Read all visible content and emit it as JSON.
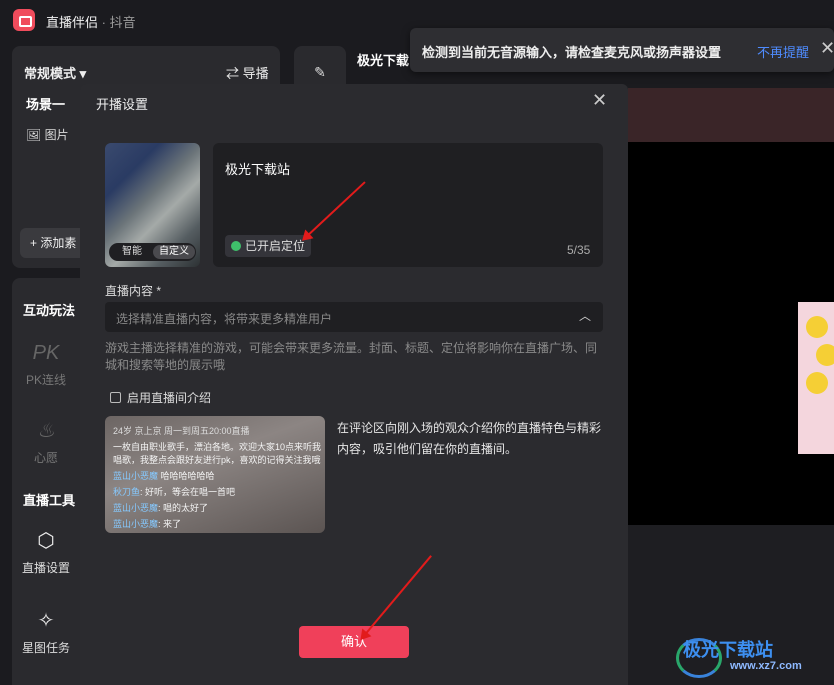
{
  "app": {
    "title": "直播伴侣",
    "subtitle": "· 抖音"
  },
  "left": {
    "mode": "常规模式",
    "guide": "导播",
    "scene": "场景一",
    "image_item": "图片",
    "add_source": "添加素",
    "interact_head": "互动玩法",
    "pk_label": "PK连线",
    "wish_label": "心愿",
    "tools_head": "直播工具",
    "live_settings": "直播设置",
    "star_task": "星图任务"
  },
  "stream_title": "极光下载",
  "notice": {
    "text": "检测到当前无音源输入，请检查麦克风或扬声器设置",
    "link": "不再提醒"
  },
  "modal": {
    "title": "开播设置",
    "cover_tabs": [
      "智能",
      "自定义"
    ],
    "live_title": "极光下载站",
    "location_badge": "已开启定位",
    "char_count": "5/35",
    "content_label": "直播内容 *",
    "content_placeholder": "选择精准直播内容，将带来更多精准用户",
    "hint": "游戏主播选择精准的游戏，可能会带来更多流量。封面、标题、定位将影响你在直播广场、同城和搜索等地的展示哦",
    "intro_checkbox": "启用直播间介绍",
    "intro_desc": "在评论区向刚入场的观众介绍你的直播特色与精彩内容，吸引他们留在你的直播间。",
    "chat": {
      "header": "24岁  京上京  周一到周五20:00直播",
      "body1": "一枚自由职业歌手，漂泊各地。欢迎大家10点来听我",
      "body2": "唱歌，我整点会跟好友进行pk，喜欢的记得关注我哦",
      "l1_user": "蓝山小恶魔",
      "l1_msg": "哈哈哈哈哈哈",
      "l2_user": "秋刀鱼",
      "l2_msg": "好听，等会在唱一首吧",
      "l3_user": "蓝山小恶魔",
      "l3_msg": "唱的太好了",
      "l4_user": "蓝山小恶魔",
      "l4_msg": "来了"
    },
    "confirm": "确认"
  },
  "watermark": {
    "brand": "极光下载站",
    "url": "www.xz7.com"
  }
}
